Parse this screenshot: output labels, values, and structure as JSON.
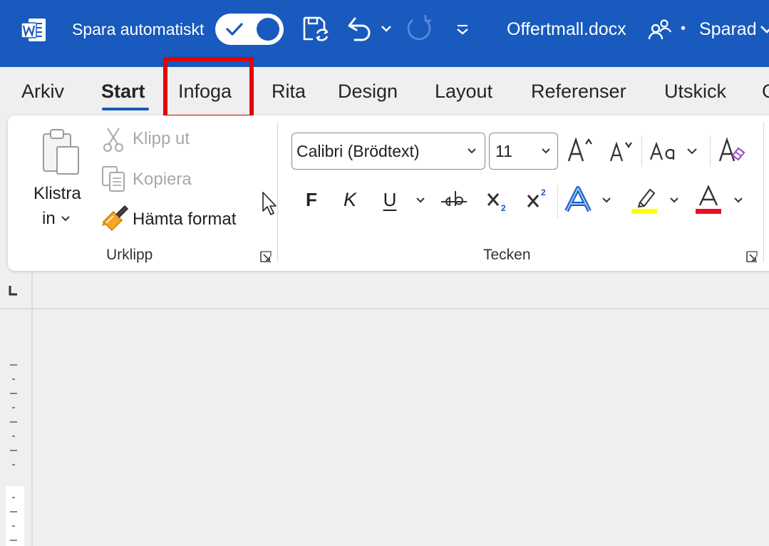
{
  "titlebar": {
    "autosave_label": "Spara automatiskt",
    "autosave_on": true,
    "document_name": "Offertmall.docx",
    "separator": "•",
    "save_status": "Sparad",
    "bg_color": "#185abd"
  },
  "tabs": [
    {
      "label": "Arkiv"
    },
    {
      "label": "Start",
      "active": true
    },
    {
      "label": "Infoga",
      "highlighted": true
    },
    {
      "label": "Rita"
    },
    {
      "label": "Design"
    },
    {
      "label": "Layout"
    },
    {
      "label": "Referenser"
    },
    {
      "label": "Utskick"
    },
    {
      "label": "G"
    }
  ],
  "clipboard": {
    "paste_label_1": "Klistra",
    "paste_label_2": "in",
    "cut_label": "Klipp ut",
    "copy_label": "Kopiera",
    "format_painter_label": "Hämta format",
    "group_label": "Urklipp"
  },
  "font": {
    "font_name": "Calibri (Brödtext)",
    "font_size": "11",
    "bold_glyph": "F",
    "italic_glyph": "K",
    "underline_glyph": "U",
    "group_label": "Tecken",
    "highlight_color": "#ffff00",
    "font_color": "#e81123"
  },
  "colors": {
    "accent": "#185abd",
    "annotation_box": "#e30000"
  }
}
